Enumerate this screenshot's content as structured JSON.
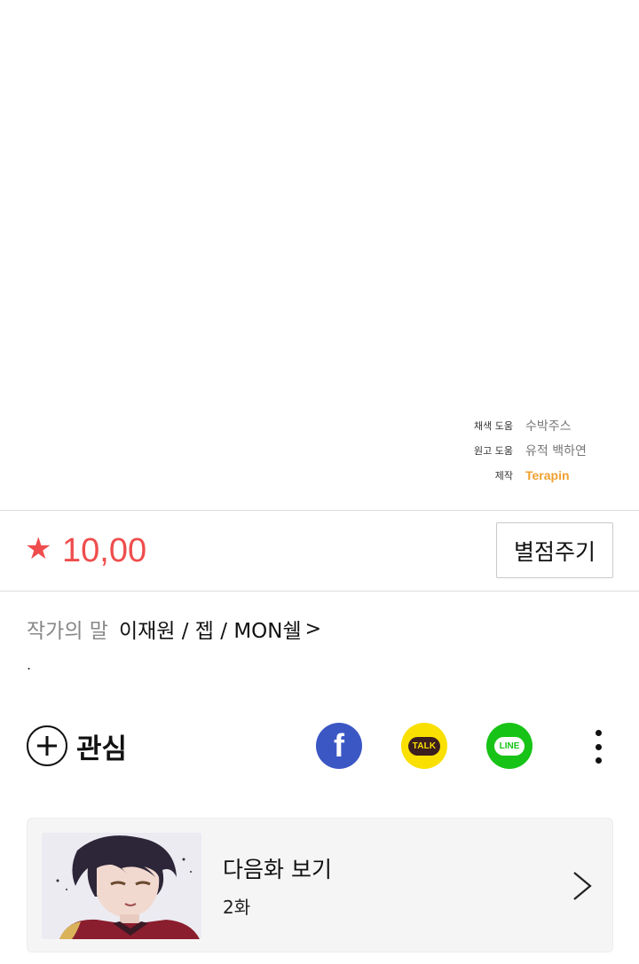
{
  "credits": [
    {
      "role": "채색 도움",
      "name": "수박주스"
    },
    {
      "role": "원고 도움",
      "name": "유적 백하연"
    },
    {
      "role": "제작",
      "name": "Terapin"
    }
  ],
  "rating": {
    "star_icon": "★",
    "score": "10,00",
    "rate_button_label": "별점주기",
    "accent_color": "#ef4d4d"
  },
  "author": {
    "prefix": "작가의 말",
    "names": "이재원 / 젭 / MON쉘",
    "arrow": ">",
    "note": "."
  },
  "actions": {
    "favorite_label": "관심",
    "share": [
      {
        "name": "facebook",
        "glyph": "f",
        "color": "#3b57c4"
      },
      {
        "name": "kakaotalk",
        "glyph": "TALK",
        "color": "#f9e000"
      },
      {
        "name": "line",
        "glyph": "LINE",
        "color": "#17c316"
      }
    ],
    "more_icon": "more-vertical-icon"
  },
  "next_episode": {
    "title": "다음화 보기",
    "episode": "2화"
  }
}
